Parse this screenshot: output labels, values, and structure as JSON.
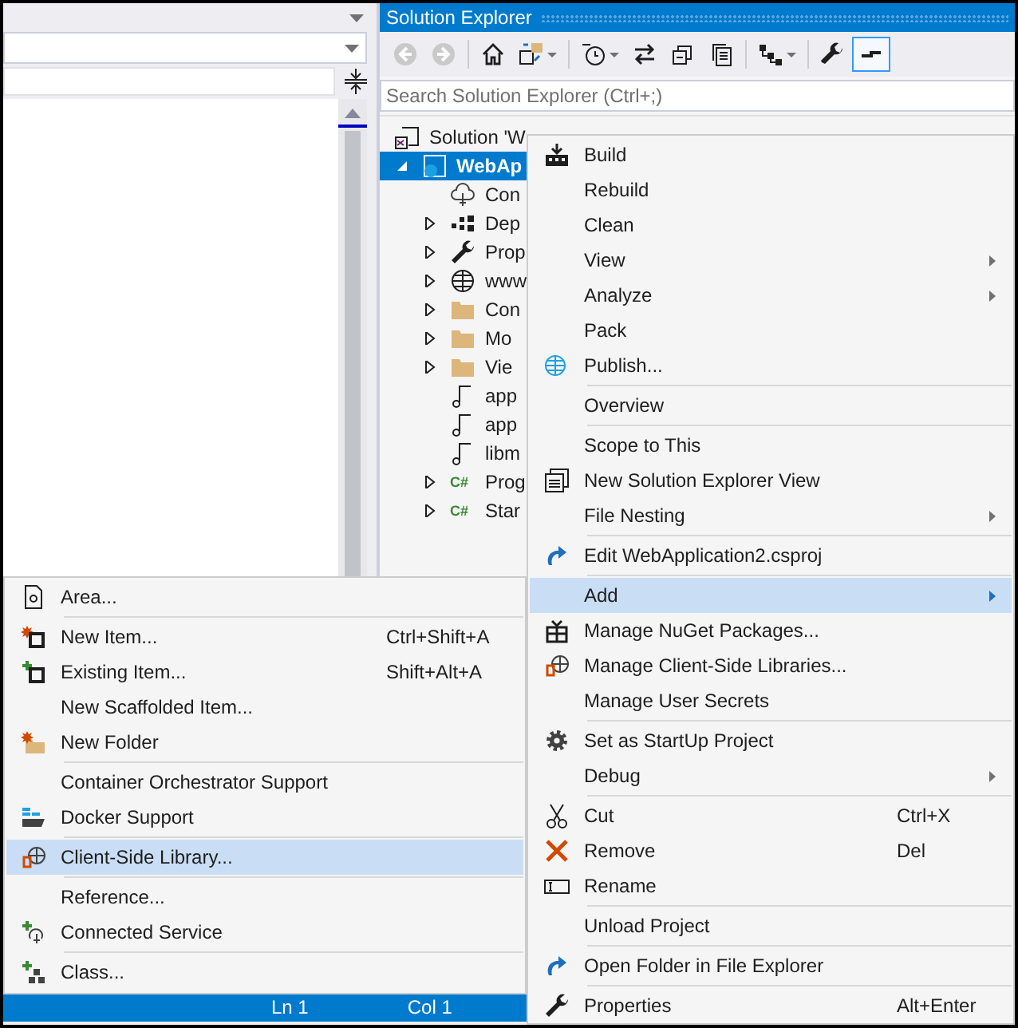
{
  "solution_explorer": {
    "title": "Solution Explorer",
    "toolbar": [
      {
        "disabled": true,
        "selected": false,
        "dropdown": false
      },
      {
        "disabled": true,
        "selected": false,
        "dropdown": false
      },
      {
        "disabled": false,
        "selected": false,
        "dropdown": false
      },
      {
        "disabled": false,
        "selected": false,
        "dropdown": true
      },
      {
        "disabled": false,
        "selected": false,
        "dropdown": true
      },
      {
        "disabled": false,
        "selected": false,
        "dropdown": false
      },
      {
        "disabled": false,
        "selected": false,
        "dropdown": false
      },
      {
        "disabled": false,
        "selected": false,
        "dropdown": false
      },
      {
        "disabled": false,
        "selected": false,
        "dropdown": true
      },
      {
        "disabled": false,
        "selected": false,
        "dropdown": false
      },
      {
        "disabled": false,
        "selected": true,
        "dropdown": false
      }
    ],
    "search": {
      "placeholder": "Search Solution Explorer (Ctrl+;)"
    },
    "tree": [
      {
        "label": "Solution 'W",
        "children": [
          {
            "label": "WebAp",
            "selected": true,
            "expanded": true,
            "children": [
              {
                "label": "Con"
              },
              {
                "label": "Dep",
                "expanded": false
              },
              {
                "label": "Prop",
                "expanded": false
              },
              {
                "label": "www",
                "expanded": false
              },
              {
                "label": "Con",
                "expanded": false
              },
              {
                "label": "Mo",
                "expanded": false
              },
              {
                "label": "Vie",
                "expanded": false
              },
              {
                "label": "app"
              },
              {
                "label": "app"
              },
              {
                "label": "libm"
              },
              {
                "label": "Prog",
                "badge": "C#",
                "expanded": false
              },
              {
                "label": "Star",
                "badge": "C#",
                "expanded": false
              }
            ]
          }
        ]
      }
    ]
  },
  "context_menu": {
    "groups": [
      [
        {
          "label": "Build",
          "selected": false,
          "submenu": false
        },
        {
          "label": "Rebuild",
          "selected": false,
          "submenu": false
        },
        {
          "label": "Clean",
          "selected": false,
          "submenu": false
        },
        {
          "label": "View",
          "selected": false,
          "submenu": true
        },
        {
          "label": "Analyze",
          "selected": false,
          "submenu": true
        },
        {
          "label": "Pack",
          "selected": false,
          "submenu": false
        },
        {
          "label": "Publish...",
          "selected": false,
          "submenu": false
        }
      ],
      [
        {
          "label": "Overview",
          "selected": false,
          "submenu": false
        }
      ],
      [
        {
          "label": "Scope to This",
          "selected": false,
          "submenu": false
        },
        {
          "label": "New Solution Explorer View",
          "selected": false,
          "submenu": false
        },
        {
          "label": "File Nesting",
          "selected": false,
          "submenu": true
        }
      ],
      [
        {
          "label": "Edit WebApplication2.csproj",
          "selected": false,
          "submenu": false
        }
      ],
      [
        {
          "label": "Add",
          "selected": true,
          "submenu": true
        },
        {
          "label": "Manage NuGet Packages...",
          "selected": false,
          "submenu": false
        },
        {
          "label": "Manage Client-Side Libraries...",
          "selected": false,
          "submenu": false
        },
        {
          "label": "Manage User Secrets",
          "selected": false,
          "submenu": false
        }
      ],
      [
        {
          "label": "Set as StartUp Project",
          "selected": false,
          "submenu": false
        },
        {
          "label": "Debug",
          "selected": false,
          "submenu": true
        }
      ],
      [
        {
          "label": "Cut",
          "shortcut": "Ctrl+X",
          "selected": false,
          "submenu": false
        },
        {
          "label": "Remove",
          "shortcut": "Del",
          "selected": false,
          "submenu": false
        },
        {
          "label": "Rename",
          "selected": false,
          "submenu": false
        }
      ],
      [
        {
          "label": "Unload Project",
          "selected": false,
          "submenu": false
        }
      ],
      [
        {
          "label": "Open Folder in File Explorer",
          "selected": false,
          "submenu": false
        }
      ],
      [
        {
          "label": "Properties",
          "shortcut": "Alt+Enter",
          "selected": false,
          "submenu": false
        }
      ]
    ]
  },
  "add_submenu": {
    "groups": [
      [
        {
          "label": "Area...",
          "selected": false
        }
      ],
      [
        {
          "label": "New Item...",
          "shortcut": "Ctrl+Shift+A",
          "selected": false
        },
        {
          "label": "Existing Item...",
          "shortcut": "Shift+Alt+A",
          "selected": false
        },
        {
          "label": "New Scaffolded Item...",
          "selected": false
        },
        {
          "label": "New Folder",
          "selected": false
        }
      ],
      [
        {
          "label": "Container Orchestrator Support",
          "selected": false
        },
        {
          "label": "Docker Support",
          "selected": false
        }
      ],
      [
        {
          "label": "Client-Side Library...",
          "selected": true
        }
      ],
      [
        {
          "label": "Reference...",
          "selected": false
        },
        {
          "label": "Connected Service",
          "selected": false
        }
      ],
      [
        {
          "label": "Class...",
          "selected": false
        }
      ]
    ]
  },
  "status_bar": {
    "line": "Ln 1",
    "column": "Col 1"
  }
}
